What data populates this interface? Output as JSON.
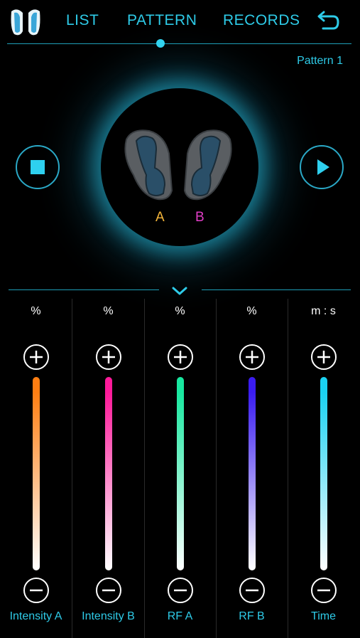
{
  "header": {
    "tabs": [
      {
        "label": "LIST"
      },
      {
        "label": "PATTERN"
      },
      {
        "label": "RECORDS"
      }
    ],
    "active_tab": "PATTERN",
    "back_icon": "back-arrow-icon",
    "logo_icon": "earbuds-logo-icon"
  },
  "pattern_name": "Pattern 1",
  "player": {
    "stop_icon": "stop-icon",
    "play_icon": "play-icon",
    "earbud_a_label": "A",
    "earbud_b_label": "B",
    "earbud_a_color": "#f4b53a",
    "earbud_b_color": "#e23ec7"
  },
  "sliders": [
    {
      "unit": "%",
      "name": "Intensity A",
      "color": "#ff7e12"
    },
    {
      "unit": "%",
      "name": "Intensity B",
      "color": "#ff1a9a"
    },
    {
      "unit": "%",
      "name": "RF A",
      "color": "#18e8a0"
    },
    {
      "unit": "%",
      "name": "RF B",
      "color": "#3a1cf0"
    },
    {
      "unit": "m : s",
      "name": "Time",
      "color": "#1ad2f2"
    }
  ],
  "accent_color": "#2ecbe8"
}
